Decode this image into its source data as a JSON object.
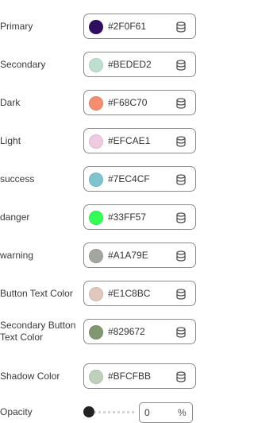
{
  "colors": [
    {
      "label": "Primary",
      "hex": "#2F0F61"
    },
    {
      "label": "Secondary",
      "hex": "#BEDED2"
    },
    {
      "label": "Dark",
      "hex": "#F68C70"
    },
    {
      "label": "Light",
      "hex": "#EFCAE1"
    },
    {
      "label": "success",
      "hex": "#7EC4CF"
    },
    {
      "label": "danger",
      "hex": "#33FF57"
    },
    {
      "label": "warning",
      "hex": "#A1A79E"
    },
    {
      "label": "Button Text Color",
      "hex": "#E1C8BC"
    },
    {
      "label": "Secondary Button Text Color",
      "hex": "#829672"
    },
    {
      "label": "Shadow Color",
      "hex": "#BFCFBB"
    }
  ],
  "opacity": {
    "label": "Opacity",
    "value": "0",
    "unit": "%",
    "level": 0
  },
  "icons": {
    "field_action": "database-icon",
    "slider_thumb": "slider-thumb"
  }
}
